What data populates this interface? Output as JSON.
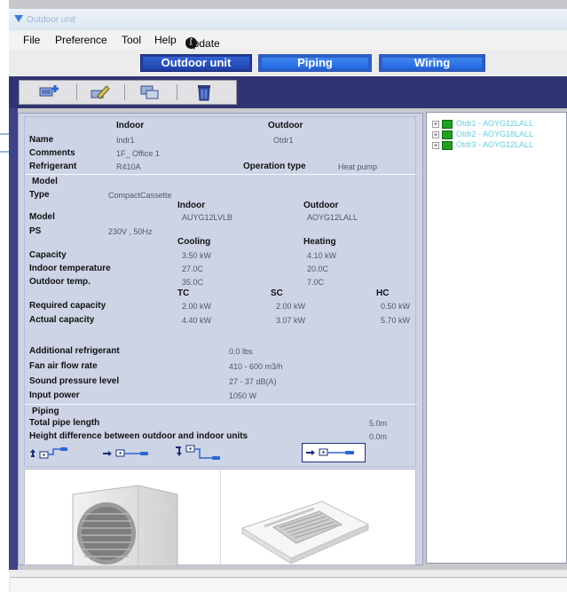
{
  "window": {
    "title": "Outdoor unit"
  },
  "menu": {
    "file": "File",
    "preference": "Preference",
    "tool": "Tool",
    "help": "Help",
    "update": "Update",
    "info_glyph": "i"
  },
  "tabs": [
    {
      "label": "Outdoor unit",
      "active": true
    },
    {
      "label": "Piping",
      "active": false
    },
    {
      "label": "Wiring",
      "active": false
    }
  ],
  "toolbar": {
    "icons": [
      "add-unit-icon",
      "edit-icon",
      "copy-icon",
      "delete-icon"
    ]
  },
  "headers": {
    "indoor": "Indoor",
    "outdoor": "Outdoor"
  },
  "general": {
    "name_label": "Name",
    "indoor_name": "Indr1",
    "outdoor_name": "Otdr1",
    "comments_label": "Comments",
    "comments": "1F_ Office 1",
    "refrigerant_label": "Refrigerant",
    "refrigerant": "R410A",
    "operation_type_label": "Operation type",
    "operation_type": "Heat pump"
  },
  "model": {
    "section_label": "Model",
    "type_label": "Type",
    "type": "CompactCassette",
    "model_label": "Model",
    "indoor_model": "AUYG12LVLB",
    "outdoor_model": "AOYG12LALL",
    "ps_label": "PS",
    "ps": "230V , 50Hz",
    "cooling_header": "Cooling",
    "heating_header": "Heating",
    "capacity_label": "Capacity",
    "capacity_cooling": "3.50 kW",
    "capacity_heating": "4.10 kW",
    "indoor_temp_label": "Indoor temperature",
    "indoor_temp_cooling": "27.0C",
    "indoor_temp_heating": "20.0C",
    "outdoor_temp_label": "Outdoor temp.",
    "outdoor_temp_cooling": "35.0C",
    "outdoor_temp_heating": "7.0C",
    "tc_header": "TC",
    "sc_header": "SC",
    "hc_header": "HC",
    "required_label": "Required capacity",
    "required_tc": "2.00 kW",
    "required_sc": "2.00 kW",
    "required_hc": "0.50 kW",
    "actual_label": "Actual capacity",
    "actual_tc": "4.40 kW",
    "actual_sc": "3.07 kW",
    "actual_hc": "5.70 kW"
  },
  "extras": {
    "additional_refrigerant_label": "Additional refrigerant",
    "additional_refrigerant": "0.0 lbs",
    "fan_label": "Fan air flow rate",
    "fan": "410 - 600 m3/h",
    "sound_label": "Sound pressure level",
    "sound": "27 - 37 dB(A)",
    "input_power_label": "Input power",
    "input_power": "1050 W"
  },
  "piping": {
    "section_label": "Piping",
    "total_length_label": "Total pipe length",
    "total_length": "5.0m",
    "height_diff_label": "Height difference between outdoor and indoor units",
    "height_diff": "0.0m",
    "layout_icons": [
      "pipe-layout-up-icon",
      "pipe-layout-level-icon",
      "pipe-layout-down-icon",
      "pipe-layout-level-selected-icon"
    ]
  },
  "tree": {
    "items": [
      {
        "label": "Otdr1 - AOYG12LALL"
      },
      {
        "label": "Otdr2 - AOYG18LALL"
      },
      {
        "label": "Otdr3 - AOYG12LALL"
      }
    ]
  },
  "colors": {
    "navy": "#2f3572",
    "panel": "#cdd4e6",
    "tab": "#2357d8",
    "tree_text": "#5fd2e6"
  }
}
